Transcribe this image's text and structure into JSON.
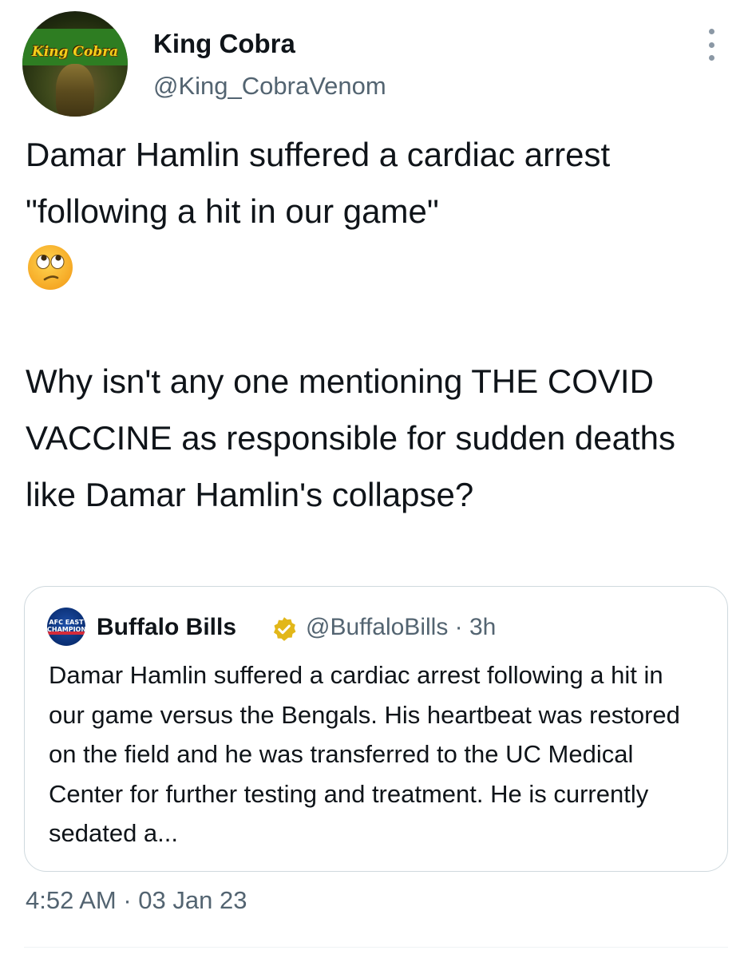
{
  "author": {
    "avatar_logo": "King Cobra",
    "display_name": "King Cobra",
    "handle": "@King_CobraVenom"
  },
  "more_icon": "more-dots-vertical-icon",
  "tweet": {
    "text_part1": "Damar Hamlin suffered a cardiac arrest \"following a hit in our game\"",
    "emoji": "face-with-rolling-eyes",
    "text_part2": "Why isn't any one mentioning THE COVID VACCINE as responsible for sudden deaths like Damar Hamlin's collapse?"
  },
  "quoted_tweet": {
    "avatar_text": "AFC EAST CHAMPIONS",
    "display_name": "Buffalo Bills",
    "verified_icon": "verified-badge-gold-icon",
    "meta": "@BuffaloBills · 3h",
    "text": "Damar Hamlin suffered a cardiac arrest following a hit in our game versus the Bengals. His heartbeat was restored on the field and he was transferred to the UC Medical Center for further testing and treatment. He is currently sedated a..."
  },
  "timestamp": "4:52 AM · 03 Jan 23",
  "colors": {
    "text_primary": "#0f1419",
    "text_secondary": "#536471",
    "border": "#cfd9de",
    "verified_gold": "#e2b719",
    "avatar_green": "#2e7d22",
    "avatar_logo_yellow": "#f4d11a"
  }
}
